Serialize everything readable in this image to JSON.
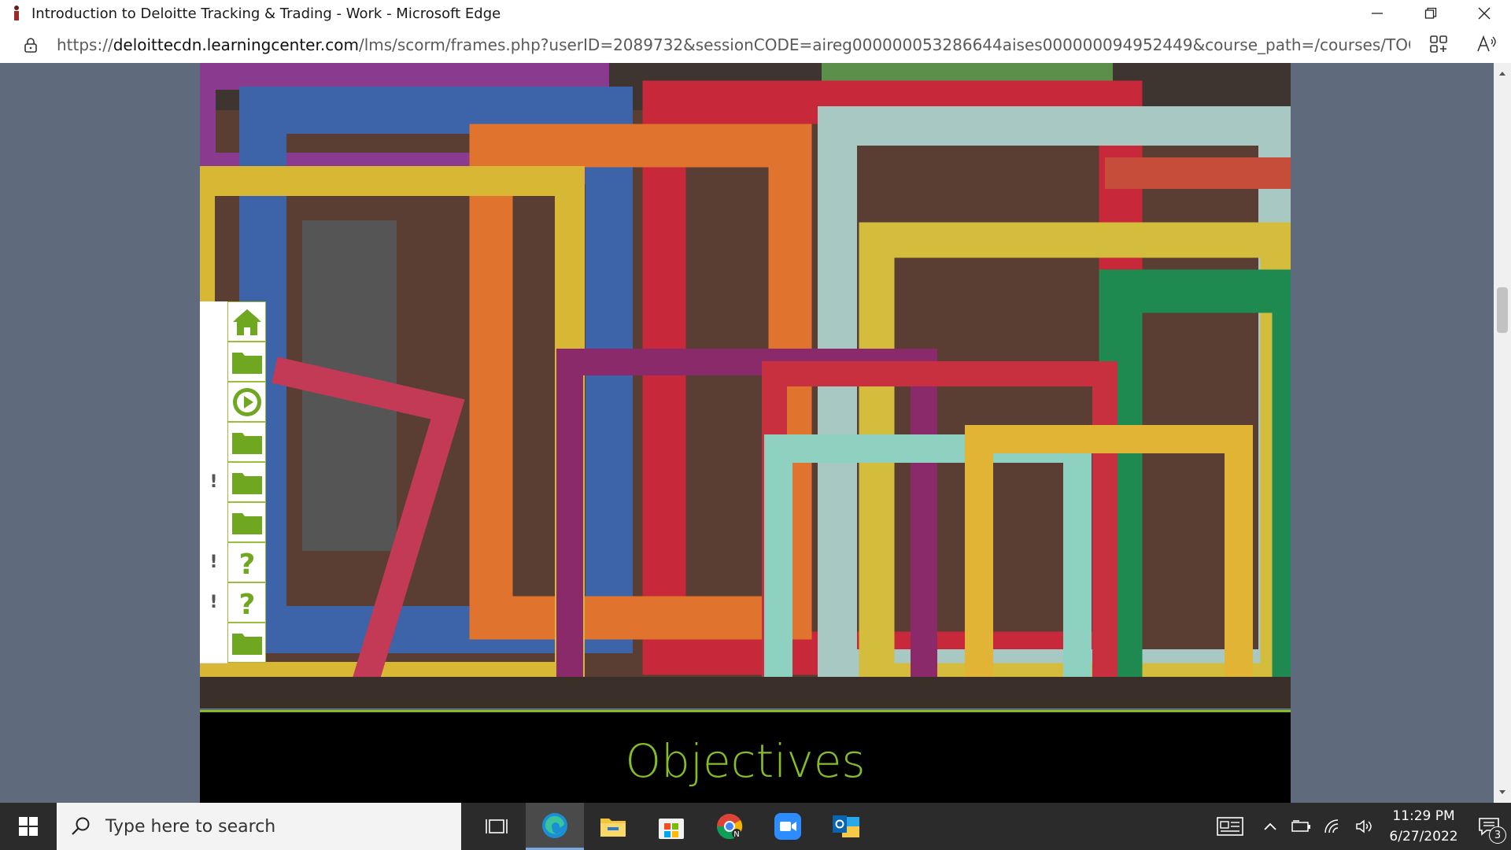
{
  "window": {
    "title": "Introduction to Deloitte Tracking & Trading - Work - Microsoft Edge",
    "app_icon": "deloitte-person-icon"
  },
  "address_bar": {
    "url_prefix": "https://",
    "url_host": "deloittecdn.learningcenter.com",
    "url_path": "/lms/scorm/frames.php?userID=2089732&sessionCODE=aireg000000053286644aises000000094952449&course_path=/courses/TOOLS/12497_TT..."
  },
  "course": {
    "heading": "Objectives",
    "accent_color": "#86bc25",
    "nav_items": [
      {
        "icon": "home-icon",
        "flag": ""
      },
      {
        "icon": "folder-icon",
        "flag": ""
      },
      {
        "icon": "play-icon",
        "flag": ""
      },
      {
        "icon": "folder-icon",
        "flag": ""
      },
      {
        "icon": "folder-icon",
        "flag": "!"
      },
      {
        "icon": "folder-icon",
        "flag": ""
      },
      {
        "icon": "question-icon",
        "flag": "!"
      },
      {
        "icon": "question-icon",
        "flag": "!"
      },
      {
        "icon": "folder-icon",
        "flag": ""
      }
    ]
  },
  "taskbar": {
    "search_placeholder": "Type here to search",
    "time": "11:29 PM",
    "date": "6/27/2022",
    "notification_count": "3"
  }
}
